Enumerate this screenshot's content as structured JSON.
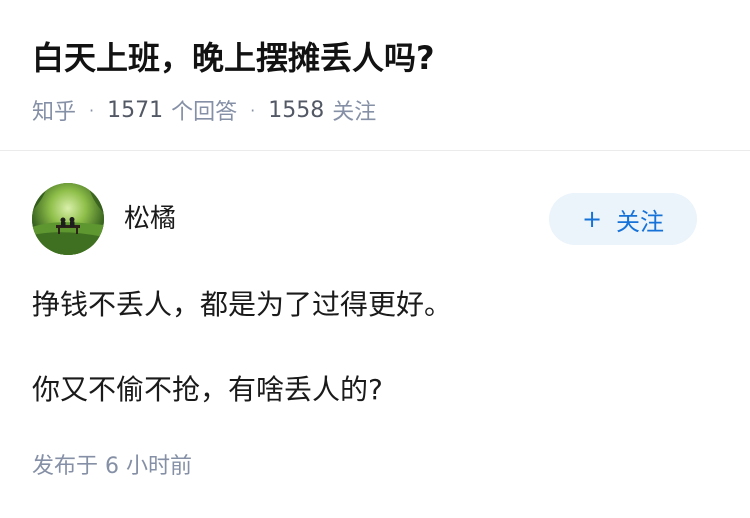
{
  "question": {
    "title": "白天上班，晚上摆摊丢人吗?",
    "source": "知乎",
    "answer_count": "1571",
    "answer_label": "个回答",
    "follower_count": "1558",
    "follower_label": "关注"
  },
  "answer": {
    "author": {
      "name": "松橘",
      "avatar_icon": "avatar-park-bench-photo"
    },
    "follow_button": {
      "icon": "plus-icon",
      "icon_glyph": "+",
      "label": "关注"
    },
    "paragraphs": [
      "挣钱不丢人，都是为了过得更好。",
      "你又不偷不抢，有啥丢人的?"
    ],
    "published_label": "发布于",
    "published_time": "6 小时前"
  },
  "colors": {
    "accent": "#1772d8",
    "follow_button_bg": "#ebf3fb",
    "meta_text": "#8590a6",
    "title_text": "#121212"
  }
}
